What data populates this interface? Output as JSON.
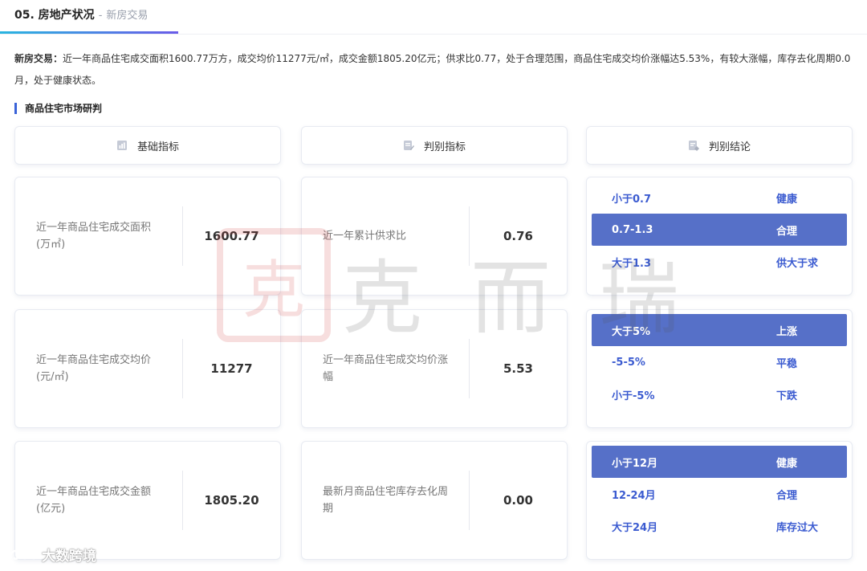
{
  "header": {
    "number_title": "05. 房地产状况",
    "separator": "-",
    "subtitle": "新房交易"
  },
  "summary": {
    "lead": "新房交易：",
    "text": "近一年商品住宅成交面积1600.77万方，成交均价11277元/㎡，成交金额1805.20亿元；供求比0.77，处于合理范围，商品住宅成交均价涨幅达5.53%，有较大涨幅，库存去化周期0.0月，处于健康状态。"
  },
  "section": {
    "title": "商品住宅市场研判"
  },
  "columns": {
    "basic": "基础指标",
    "judge": "判别指标",
    "conclusion": "判别结论"
  },
  "basic_metrics": [
    {
      "label": "近一年商品住宅成交面积(万㎡)",
      "value": "1600.77"
    },
    {
      "label": "近一年商品住宅成交均价(元/㎡)",
      "value": "11277"
    },
    {
      "label": "近一年商品住宅成交金额(亿元)",
      "value": "1805.20"
    }
  ],
  "judge_metrics": [
    {
      "label": "近一年累计供求比",
      "value": "0.76"
    },
    {
      "label": "近一年商品住宅成交均价涨幅",
      "value": "5.53"
    },
    {
      "label": "最新月商品住宅库存去化周期",
      "value": "0.00"
    }
  ],
  "conclusions": [
    {
      "rows": [
        {
          "range": "小于0.7",
          "verdict": "健康"
        },
        {
          "range": "0.7-1.3",
          "verdict": "合理"
        },
        {
          "range": "大于1.3",
          "verdict": "供大于求"
        }
      ]
    },
    {
      "rows": [
        {
          "range": "大于5%",
          "verdict": "上涨"
        },
        {
          "range": "-5-5%",
          "verdict": "平稳"
        },
        {
          "range": "小于-5%",
          "verdict": "下跌"
        }
      ]
    },
    {
      "rows": [
        {
          "range": "小于12月",
          "verdict": "健康"
        },
        {
          "range": "12-24月",
          "verdict": "合理"
        },
        {
          "range": "大于24月",
          "verdict": "库存过大"
        }
      ]
    }
  ],
  "watermark": {
    "seal": "克",
    "text": "克而瑞"
  },
  "footer": {
    "brand": "大数跨境"
  },
  "colors": {
    "accent": "#3b5bd0",
    "active_row": "#5670c8",
    "underline_start": "#29b5e0",
    "underline_end": "#6a5be8"
  }
}
